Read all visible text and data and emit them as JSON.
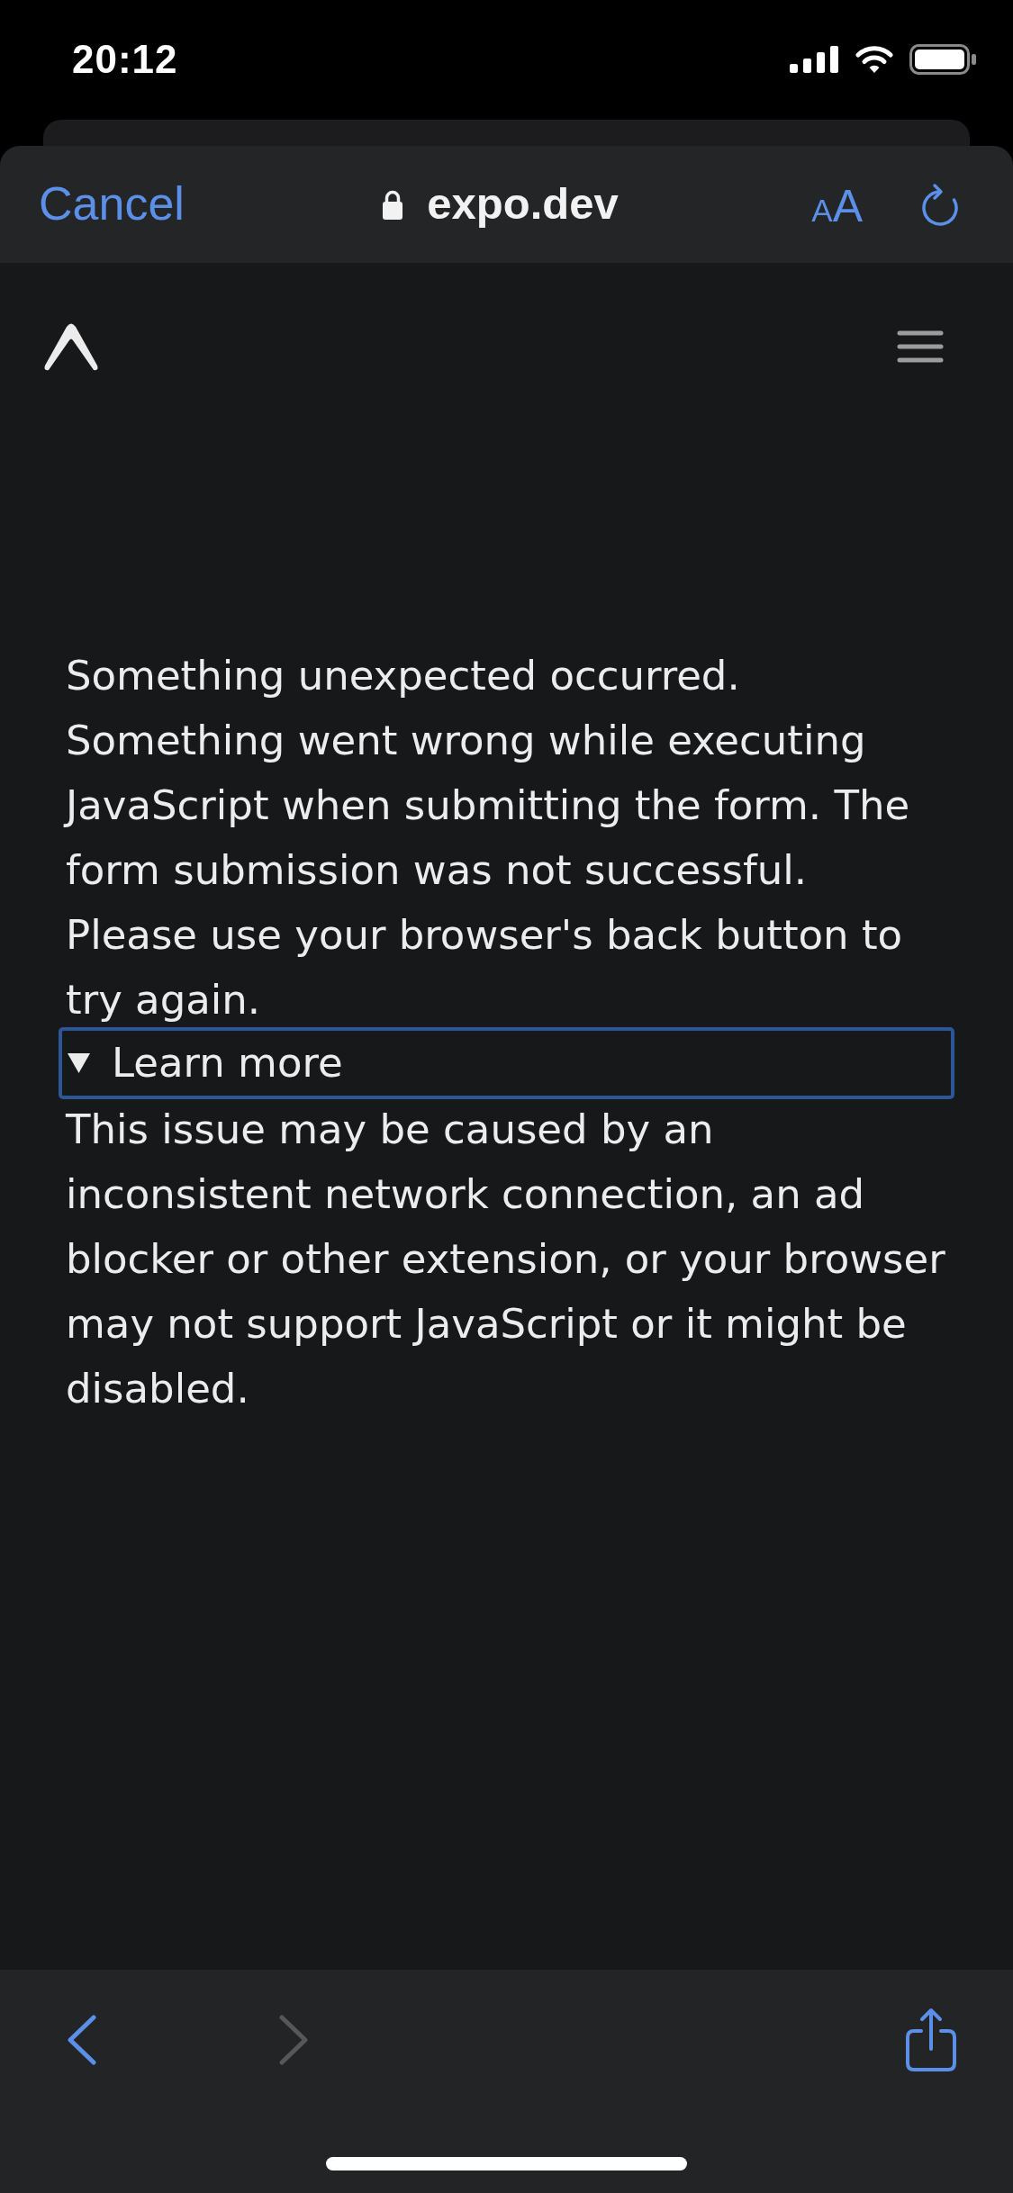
{
  "status_bar": {
    "time": "20:12"
  },
  "browser_bar": {
    "cancel": "Cancel",
    "secure": true,
    "url": "expo.dev",
    "format_button": "AA"
  },
  "page": {
    "heading": "Something unexpected occurred.",
    "message": [
      "Something went wrong while executing JavaScript when submitting the form. The form submission was not successful.",
      "Please use your browser's back button to try again."
    ],
    "details": {
      "summary": "Learn more",
      "expanded": true,
      "text": "This issue may be caused by an inconsistent network connection, an ad blocker or other extension, or your browser may not support JavaScript or it might be disabled."
    }
  },
  "toolbar": {
    "buttons": [
      {
        "kind": "back",
        "disabled": false
      },
      {
        "kind": "forward",
        "disabled": true
      },
      {
        "kind": "share",
        "disabled": false
      }
    ]
  }
}
